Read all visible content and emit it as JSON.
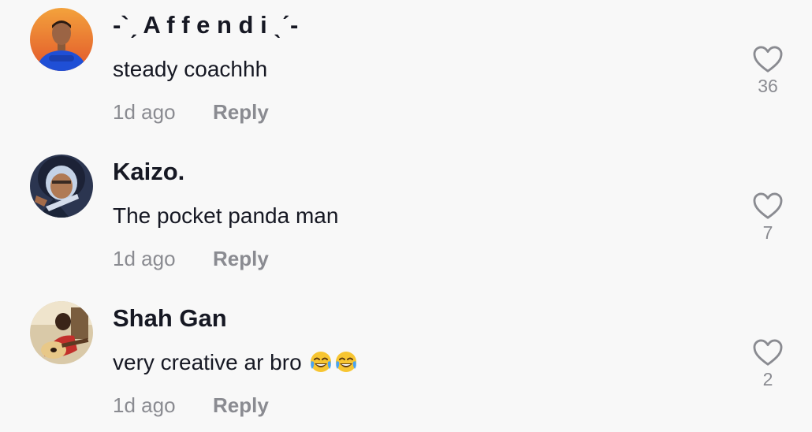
{
  "comments": [
    {
      "username": "-`ˏ A f f e n d i ˎˊ-",
      "text": "steady coachhh",
      "time": "1d ago",
      "reply_label": "Reply",
      "likes": "36"
    },
    {
      "username": "Kaizo.",
      "text": "The pocket panda man",
      "time": "1d ago",
      "reply_label": "Reply",
      "likes": "7"
    },
    {
      "username": "Shah Gan",
      "text": "very creative ar bro",
      "emojis": [
        "face-with-tears-of-joy-icon",
        "face-with-tears-of-joy-icon"
      ],
      "time": "1d ago",
      "reply_label": "Reply",
      "likes": "2"
    }
  ],
  "colors": {
    "background": "#f8f8f8",
    "primary_text": "#161823",
    "secondary_text": "#8a8b91"
  }
}
